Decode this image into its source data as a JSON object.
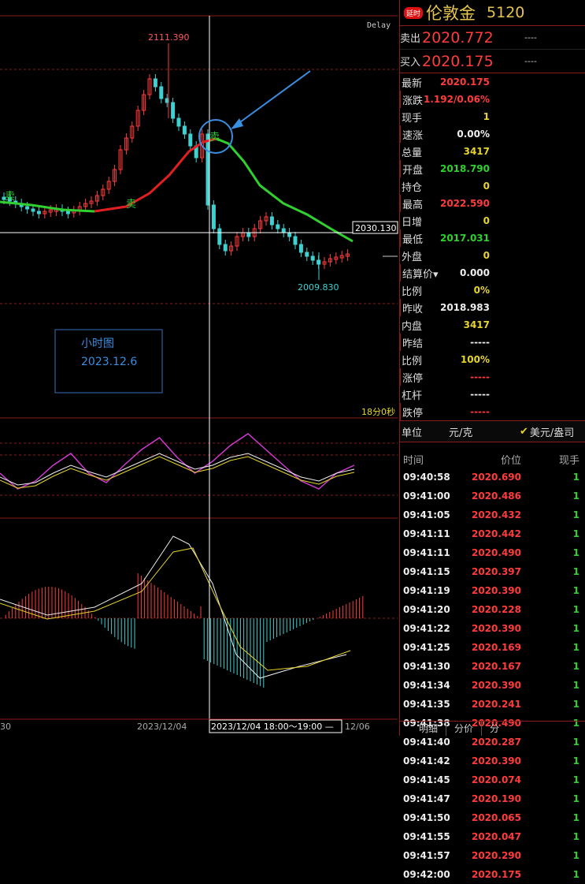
{
  "chart": {
    "delay_label": "Delay",
    "high_label": "2111.390",
    "low_label": "2009.830",
    "crosshair_price": "2030.130",
    "countdown": "18分0秒",
    "sell_marker": "卖",
    "note_title": "小时图",
    "note_date": "2023.12.6",
    "x_ticks": [
      "30",
      "2023/12/04",
      "2023/12/04 18:00～19:00 —",
      "12/06"
    ]
  },
  "panel": {
    "badge": "延时",
    "name": "伦敦金",
    "code": "5120",
    "ask_label": "卖出",
    "ask_price": "2020.772",
    "ask_dash": "----",
    "bid_label": "买入",
    "bid_price": "2020.175",
    "bid_dash": "----",
    "stats": [
      {
        "k": "最新",
        "v": "2020.175",
        "c": "red"
      },
      {
        "k": "涨跌",
        "v": "1.192/0.06%",
        "c": "red"
      },
      {
        "k": "现手",
        "v": "1",
        "c": "yellow"
      },
      {
        "k": "速涨",
        "v": "0.00%",
        "c": "white"
      },
      {
        "k": "总量",
        "v": "3417",
        "c": "yellow"
      },
      {
        "k": "开盘",
        "v": "2018.790",
        "c": "green"
      },
      {
        "k": "持仓",
        "v": "0",
        "c": "yellow"
      },
      {
        "k": "最高",
        "v": "2022.590",
        "c": "red"
      },
      {
        "k": "日增",
        "v": "0",
        "c": "yellow"
      },
      {
        "k": "最低",
        "v": "2017.031",
        "c": "green"
      },
      {
        "k": "外盘",
        "v": "0",
        "c": "yellow"
      },
      {
        "k": "结算价▾",
        "v": "0.000",
        "c": "white"
      },
      {
        "k": "比例",
        "v": "0%",
        "c": "yellow"
      },
      {
        "k": "昨收",
        "v": "2018.983",
        "c": "white"
      },
      {
        "k": "内盘",
        "v": "3417",
        "c": "yellow"
      },
      {
        "k": "昨结",
        "v": "-----",
        "c": "white"
      },
      {
        "k": "比例",
        "v": "100%",
        "c": "yellow"
      },
      {
        "k": "涨停",
        "v": "-----",
        "c": "red"
      },
      {
        "k": "杠杆",
        "v": "-----",
        "c": "white"
      },
      {
        "k": "跌停",
        "v": "-----",
        "c": "red"
      }
    ],
    "unit_label": "单位",
    "unit_value": "元/克",
    "unit_alt": "美元/盎司",
    "trade_headers": [
      "时间",
      "价位",
      "现手"
    ],
    "trades": [
      [
        "09:40:58",
        "2020.690",
        "1"
      ],
      [
        "09:41:00",
        "2020.486",
        "1"
      ],
      [
        "09:41:05",
        "2020.432",
        "1"
      ],
      [
        "09:41:11",
        "2020.442",
        "1"
      ],
      [
        "09:41:11",
        "2020.490",
        "1"
      ],
      [
        "09:41:15",
        "2020.397",
        "1"
      ],
      [
        "09:41:19",
        "2020.390",
        "1"
      ],
      [
        "09:41:20",
        "2020.228",
        "1"
      ],
      [
        "09:41:22",
        "2020.390",
        "1"
      ],
      [
        "09:41:25",
        "2020.169",
        "1"
      ],
      [
        "09:41:30",
        "2020.167",
        "1"
      ],
      [
        "09:41:34",
        "2020.390",
        "1"
      ],
      [
        "09:41:35",
        "2020.241",
        "1"
      ],
      [
        "09:41:38",
        "2020.490",
        "1"
      ],
      [
        "09:41:40",
        "2020.287",
        "1"
      ],
      [
        "09:41:42",
        "2020.390",
        "1"
      ],
      [
        "09:41:45",
        "2020.074",
        "1"
      ],
      [
        "09:41:47",
        "2020.190",
        "1"
      ],
      [
        "09:41:50",
        "2020.065",
        "1"
      ],
      [
        "09:41:55",
        "2020.047",
        "1"
      ],
      [
        "09:41:57",
        "2020.290",
        "1"
      ],
      [
        "09:42:00",
        "2020.175",
        "1"
      ]
    ],
    "tabs": [
      "明细",
      "分价",
      "分"
    ]
  },
  "colors": {
    "up": "#ff3c3c",
    "down": "#3fd0d0",
    "ma_up": "#e02020",
    "ma_down": "#30d030",
    "grid": "#8b1a1a"
  }
}
